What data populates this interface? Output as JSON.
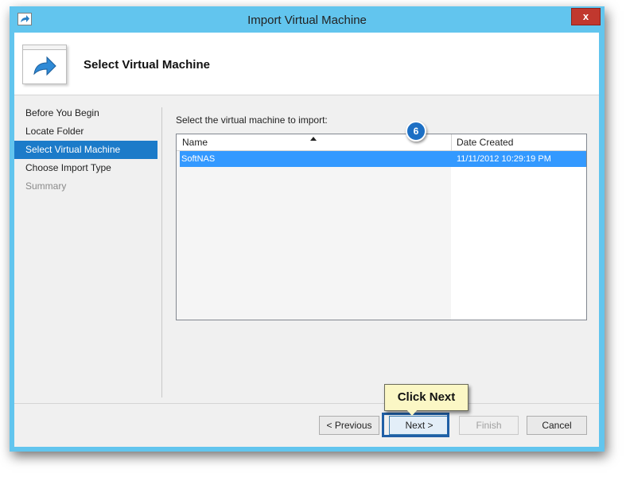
{
  "window": {
    "title": "Import Virtual Machine",
    "close_label": "x"
  },
  "header": {
    "title": "Select Virtual Machine"
  },
  "nav": {
    "items": [
      {
        "label": "Before You Begin",
        "state": "normal"
      },
      {
        "label": "Locate Folder",
        "state": "normal"
      },
      {
        "label": "Select Virtual Machine",
        "state": "selected"
      },
      {
        "label": "Choose Import Type",
        "state": "normal"
      },
      {
        "label": "Summary",
        "state": "disabled"
      }
    ]
  },
  "main": {
    "prompt": "Select the virtual machine to import:",
    "columns": {
      "name": "Name",
      "date": "Date Created"
    },
    "rows": [
      {
        "name": "SoftNAS",
        "date": "11/11/2012 10:29:19 PM"
      }
    ]
  },
  "annotation": {
    "step_badge": "6",
    "callout": "Click Next"
  },
  "buttons": {
    "previous": "< Previous",
    "next": "Next >",
    "finish": "Finish",
    "cancel": "Cancel"
  },
  "colors": {
    "titlebar": "#62c5ee",
    "selection": "#3399ff",
    "nav_selected": "#1c7bc9",
    "close": "#c1382e"
  }
}
